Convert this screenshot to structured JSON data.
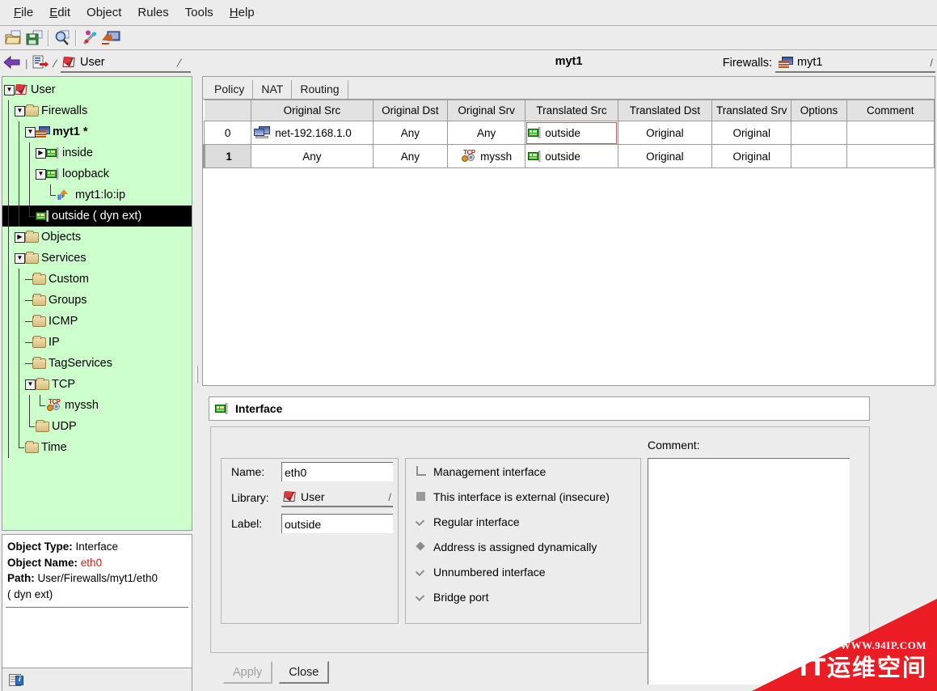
{
  "menu": {
    "items": [
      {
        "label": "File",
        "mnemonic": "F"
      },
      {
        "label": "Edit",
        "mnemonic": "E"
      },
      {
        "label": "Object",
        "mnemonic": "O"
      },
      {
        "label": "Rules",
        "mnemonic": "R"
      },
      {
        "label": "Tools",
        "mnemonic": "T"
      },
      {
        "label": "Help",
        "mnemonic": "H"
      }
    ]
  },
  "toolbar": {
    "buttons": [
      {
        "icon": "open-folder-icon",
        "label": "Open"
      },
      {
        "icon": "save-floppy-icon",
        "label": "Save"
      },
      {
        "icon": "find-magnifier-icon",
        "label": "Find"
      },
      {
        "icon": "policy-wand-icon",
        "label": "Compile"
      },
      {
        "icon": "install-icon",
        "label": "Install"
      }
    ]
  },
  "navbar": {
    "back_icon": "back-arrow-icon",
    "object_icon": "new-object-icon",
    "separator": "/",
    "library_value": "User",
    "library_icon": "user-library-icon"
  },
  "tree": {
    "items": [
      {
        "label": "User",
        "icon": "user-library-icon",
        "depth": 0,
        "expanded": true,
        "selected": false
      },
      {
        "label": "Firewalls",
        "icon": "folder-icon",
        "depth": 1,
        "expanded": true,
        "selected": false
      },
      {
        "label": "myt1 *",
        "icon": "firewall-icon",
        "depth": 2,
        "expanded": true,
        "selected": false,
        "bold": true
      },
      {
        "label": "inside",
        "icon": "interface-icon",
        "depth": 3,
        "expanded": false,
        "selected": false
      },
      {
        "label": "loopback",
        "icon": "interface-icon",
        "depth": 3,
        "expanded": true,
        "selected": false
      },
      {
        "label": "myt1:lo:ip",
        "icon": "ip-address-icon",
        "depth": 4,
        "expanded": null,
        "selected": false
      },
      {
        "label": "outside ( dyn ext)",
        "icon": "interface-icon",
        "depth": 3,
        "expanded": null,
        "selected": true
      },
      {
        "label": "Objects",
        "icon": "folder-icon",
        "depth": 1,
        "expanded": false,
        "selected": false
      },
      {
        "label": "Services",
        "icon": "folder-icon",
        "depth": 1,
        "expanded": true,
        "selected": false
      },
      {
        "label": "Custom",
        "icon": "folder-icon",
        "depth": 2,
        "expanded": null,
        "selected": false
      },
      {
        "label": "Groups",
        "icon": "folder-icon",
        "depth": 2,
        "expanded": null,
        "selected": false
      },
      {
        "label": "ICMP",
        "icon": "folder-icon",
        "depth": 2,
        "expanded": null,
        "selected": false
      },
      {
        "label": "IP",
        "icon": "folder-icon",
        "depth": 2,
        "expanded": null,
        "selected": false
      },
      {
        "label": "TagServices",
        "icon": "folder-icon",
        "depth": 2,
        "expanded": null,
        "selected": false
      },
      {
        "label": "TCP",
        "icon": "folder-icon",
        "depth": 2,
        "expanded": true,
        "selected": false
      },
      {
        "label": "myssh",
        "icon": "tcp-service-icon",
        "depth": 3,
        "expanded": null,
        "selected": false
      },
      {
        "label": "UDP",
        "icon": "folder-icon",
        "depth": 2,
        "expanded": null,
        "selected": false
      },
      {
        "label": "Time",
        "icon": "folder-icon",
        "depth": 1,
        "expanded": null,
        "selected": false
      }
    ],
    "background_color": "#ccffcc",
    "selection_color": "#000000"
  },
  "object_info": {
    "type_label": "Object Type:",
    "type_value": "Interface",
    "name_label": "Object Name:",
    "name_value": "eth0",
    "name_color": "#cc2222",
    "path_label": "Path:",
    "path_value": "User/Firewalls/myt1/eth0",
    "path_suffix": "( dyn ext)",
    "status_icon": "info-page-icon"
  },
  "main": {
    "title": "myt1",
    "firewalls_label": "Firewalls:",
    "firewalls_value": "myt1",
    "firewalls_icon": "firewall-icon",
    "tabs": [
      {
        "label": "Policy",
        "active": false
      },
      {
        "label": "NAT",
        "active": true
      },
      {
        "label": "Routing",
        "active": false
      }
    ]
  },
  "rules_table": {
    "columns": [
      "",
      "Original Src",
      "Original Dst",
      "Original Srv",
      "Translated Src",
      "Translated Dst",
      "Translated Srv",
      "Options",
      "Comment"
    ],
    "rows": [
      {
        "num": "0",
        "current": false,
        "cells": [
          {
            "text": "net-192.168.1.0",
            "icon": "host-network-icon",
            "align": "left"
          },
          {
            "text": "Any",
            "icon": null,
            "align": "center"
          },
          {
            "text": "Any",
            "icon": null,
            "align": "center"
          },
          {
            "text": "outside",
            "icon": "interface-icon",
            "align": "left",
            "focused": true
          },
          {
            "text": "Original",
            "icon": null,
            "align": "center"
          },
          {
            "text": "Original",
            "icon": null,
            "align": "center"
          },
          {
            "text": "",
            "icon": null,
            "align": "center"
          },
          {
            "text": "",
            "icon": null,
            "align": "center"
          }
        ]
      },
      {
        "num": "1",
        "current": true,
        "cells": [
          {
            "text": "Any",
            "icon": null,
            "align": "center"
          },
          {
            "text": "Any",
            "icon": null,
            "align": "center"
          },
          {
            "text": "myssh",
            "icon": "tcp-service-icon",
            "align": "center"
          },
          {
            "text": "outside",
            "icon": "interface-icon",
            "align": "left",
            "selected": true
          },
          {
            "text": "Original",
            "icon": null,
            "align": "center"
          },
          {
            "text": "Original",
            "icon": null,
            "align": "center"
          },
          {
            "text": "",
            "icon": null,
            "align": "center"
          },
          {
            "text": "",
            "icon": null,
            "align": "center"
          }
        ]
      }
    ]
  },
  "editor": {
    "title": "Interface",
    "title_icon": "interface-icon",
    "fields": {
      "name_label": "Name:",
      "name_value": "eth0",
      "library_label": "Library:",
      "library_value": "User",
      "library_icon": "user-library-icon",
      "label_label": "Label:",
      "label_value": "outside"
    },
    "options": [
      {
        "label": "Management interface",
        "control": "checkbox",
        "checked": false
      },
      {
        "label": "This interface is external (insecure)",
        "control": "checkbox",
        "checked": true
      },
      {
        "label": "Regular interface",
        "control": "radio",
        "checked": false
      },
      {
        "label": "Address is assigned dynamically",
        "control": "radio",
        "checked": true
      },
      {
        "label": "Unnumbered interface",
        "control": "radio",
        "checked": false
      },
      {
        "label": "Bridge port",
        "control": "radio",
        "checked": false
      }
    ],
    "comment_label": "Comment:",
    "comment_value": "",
    "apply_label": "Apply",
    "apply_enabled": false,
    "close_label": "Close"
  },
  "watermark": {
    "line1": "WWW.94IP.COM",
    "line2": "IT运维空间",
    "color": "#ec1c24"
  }
}
